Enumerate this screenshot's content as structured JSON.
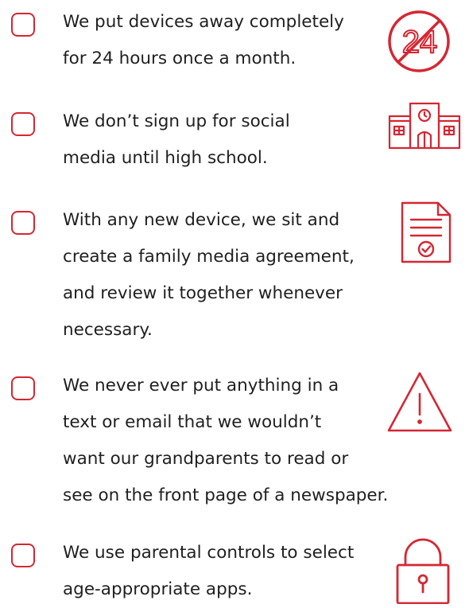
{
  "accent_color": "#d42733",
  "items": [
    {
      "lines": [
        "We put devices away completely",
        "for 24 hours once a month."
      ],
      "icon": "no-24-hours-icon",
      "icon_text": "24"
    },
    {
      "lines": [
        "We don’t sign up for social",
        "media until high school."
      ],
      "icon": "school-building-icon"
    },
    {
      "lines": [
        "With any new device, we sit and",
        "create a family media agreement,",
        "and review it together whenever",
        "necessary."
      ],
      "icon": "document-check-icon"
    },
    {
      "lines": [
        "We never ever put anything in a",
        "text or email that we wouldn’t",
        "want our grandparents to read or",
        "see on the front page of a newspaper."
      ],
      "icon": "warning-icon"
    },
    {
      "lines": [
        "We use parental controls to select",
        "age-appropriate apps."
      ],
      "icon": "padlock-icon"
    }
  ]
}
